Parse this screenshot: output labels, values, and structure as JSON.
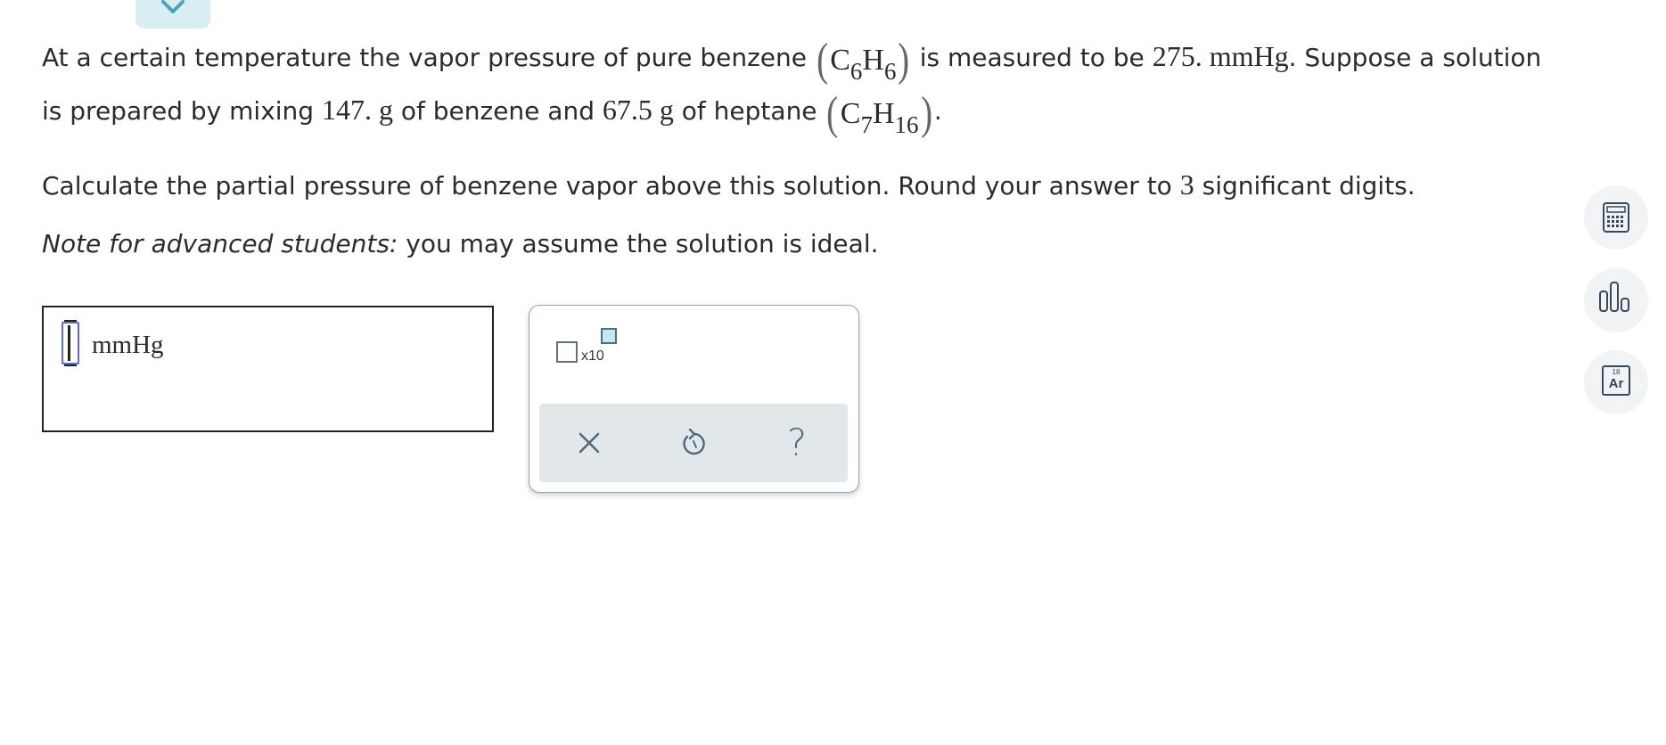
{
  "collapse": {
    "icon": "chevron-down-icon"
  },
  "problem": {
    "line1": {
      "t1": "At a certain temperature the vapor pressure of pure benzene ",
      "benzene_C": "C",
      "benzene_C_sub": "6",
      "benzene_H": "H",
      "benzene_H_sub": "6",
      "t2": " is measured to be ",
      "pressure_value": "275.",
      "pressure_unit": "mmHg",
      "t3": ". Suppose a solution"
    },
    "line2": {
      "t1": "is prepared by mixing ",
      "mass1_value": "147.",
      "mass1_unit": "g",
      "t2": " of benzene and ",
      "mass2_value": "67.5",
      "mass2_unit": "g",
      "t3": " of heptane ",
      "heptane_C": "C",
      "heptane_C_sub": "7",
      "heptane_H": "H",
      "heptane_H_sub": "16",
      "t4": "."
    },
    "line3": {
      "t1": "Calculate the partial pressure of benzene vapor above this solution. Round your answer to ",
      "sig_digits": "3",
      "t2": " significant digits."
    },
    "note": {
      "italic": "Note for advanced students:",
      "rest": " you may assume the solution is ideal."
    }
  },
  "answer": {
    "value": "",
    "unit": "mmHg"
  },
  "palette": {
    "x10_label": "x10",
    "actions": [
      "clear-icon",
      "undo-icon",
      "help-icon"
    ],
    "help_glyph": "?"
  },
  "side_tools": {
    "calculator": "calculator-icon",
    "chart": "data-chart-icon",
    "periodic_table": {
      "number": "18",
      "symbol": "Ar"
    }
  },
  "colors": {
    "accent": "#4aa3c0",
    "tab_bg": "#d9eef2",
    "cursor_box": "#5a6bd6",
    "palette_border": "#8fa3b0",
    "actions_bg": "#e2e7ea",
    "icon_gray": "#4d6a7d"
  }
}
